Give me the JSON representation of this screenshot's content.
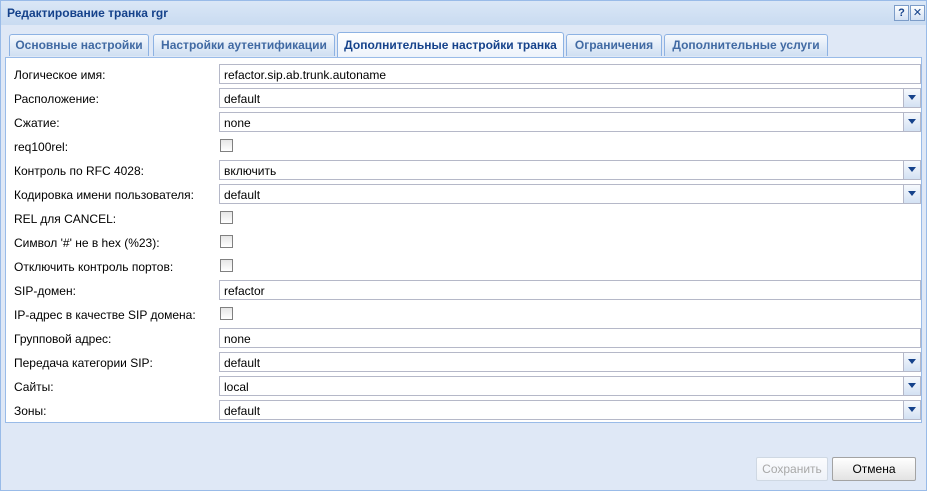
{
  "window": {
    "title": "Редактирование транка rgr",
    "help_icon": "?",
    "close_icon": "✕"
  },
  "tabs": [
    {
      "label": "Основные настройки",
      "active": false
    },
    {
      "label": "Настройки аутентификации",
      "active": false
    },
    {
      "label": "Дополнительные настройки транка",
      "active": true
    },
    {
      "label": "Ограничения",
      "active": false
    },
    {
      "label": "Дополнительные услуги",
      "active": false
    }
  ],
  "form": {
    "logical_name": {
      "label": "Логическое имя:",
      "value": "refactor.sip.ab.trunk.autoname"
    },
    "location": {
      "label": "Расположение:",
      "value": "default"
    },
    "compression": {
      "label": "Сжатие:",
      "value": "none"
    },
    "req100rel": {
      "label": "req100rel:",
      "checked": false
    },
    "rfc4028": {
      "label": "Контроль по RFC 4028:",
      "value": "включить"
    },
    "username_encoding": {
      "label": "Кодировка имени пользователя:",
      "value": "default"
    },
    "rel_for_cancel": {
      "label": "REL для CANCEL:",
      "checked": false
    },
    "hash_not_hex": {
      "label": "Символ '#' не в hex (%23):",
      "checked": false
    },
    "disable_port_control": {
      "label": "Отключить контроль портов:",
      "checked": false
    },
    "sip_domain": {
      "label": "SIP-домен:",
      "value": "refactor"
    },
    "ip_as_sip_domain": {
      "label": "IP-адрес в качестве SIP домена:",
      "checked": false
    },
    "group_address": {
      "label": "Групповой адрес:",
      "value": "none"
    },
    "sip_category": {
      "label": "Передача категории SIP:",
      "value": "default"
    },
    "sites": {
      "label": "Сайты:",
      "value": "local"
    },
    "zones": {
      "label": "Зоны:",
      "value": "default"
    }
  },
  "buttons": {
    "save": "Сохранить",
    "cancel": "Отмена"
  },
  "colors": {
    "title_text": "#15428b",
    "window_bg": "#dfe8f6",
    "border": "#99bbe8"
  }
}
